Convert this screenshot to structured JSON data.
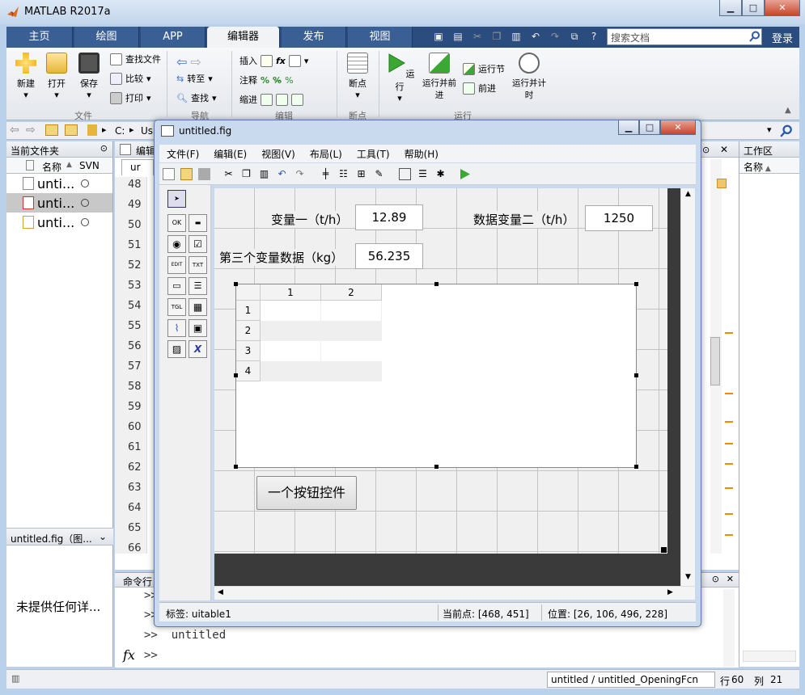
{
  "app": {
    "title": "MATLAB R2017a",
    "login": "登录",
    "search_placeholder": "搜索文档"
  },
  "tabs": [
    "主页",
    "绘图",
    "APP",
    "编辑器",
    "发布",
    "视图"
  ],
  "active_tab": "编辑器",
  "ribbon": {
    "file": {
      "new": "新建",
      "open": "打开",
      "save": "保存",
      "find_files": "查找文件",
      "compare": "比较",
      "print": "打印",
      "group": "文件"
    },
    "nav": {
      "goto": "转至",
      "find": "查找",
      "group": "导航"
    },
    "edit": {
      "insert": "插入",
      "comment": "注释",
      "indent": "缩进",
      "group": "编辑"
    },
    "breakpoints": {
      "label": "断点",
      "group": "断点"
    },
    "run": {
      "run": "运行",
      "run_advance": "运行并前进",
      "run_section": "运行节",
      "advance": "前进",
      "run_time": "运行并计时",
      "group": "运行"
    }
  },
  "address": {
    "path_start": "C:",
    "path_next": "Us"
  },
  "current_folder": {
    "title": "当前文件夹",
    "col_name": "名称",
    "col_svn": "SVN",
    "files": [
      {
        "name": "unti...",
        "selected": false
      },
      {
        "name": "unti...",
        "selected": true
      },
      {
        "name": "unti...",
        "selected": false
      }
    ],
    "details_title": "untitled.fig（图...",
    "details_text": "未提供任何详..."
  },
  "editor": {
    "tab_title": "编辑",
    "tab_file": "ur",
    "line_numbers": [
      "48",
      "49",
      "50",
      "51",
      "52",
      "53",
      "54",
      "55",
      "56",
      "57",
      "58",
      "59",
      "60",
      "61",
      "62",
      "63",
      "64",
      "65",
      "66"
    ]
  },
  "workspace": {
    "title": "工作区",
    "col_name": "名称"
  },
  "command_window": {
    "title": "命令行",
    "lines": [
      ">>",
      ">>",
      ">>  untitled",
      ">>"
    ],
    "fx": "fx"
  },
  "statusbar": {
    "file": "untitled / untitled_OpeningFcn",
    "line_label": "行",
    "line": "60",
    "col_label": "列",
    "col": "21"
  },
  "figure": {
    "title": "untitled.fig",
    "menu": [
      "文件(F)",
      "编辑(E)",
      "视图(V)",
      "布局(L)",
      "工具(T)",
      "帮助(H)"
    ],
    "palette": [
      "OK",
      "▬",
      "◉",
      "☑",
      "EDIT",
      "TXT",
      "▭",
      "☰",
      "TGL",
      "▦",
      "⌇",
      "▣",
      "▨",
      "X"
    ],
    "labels": {
      "var1": "变量一（t/h）",
      "var2": "数据变量二（t/h）",
      "var3": "第三个变量数据（kg）"
    },
    "values": {
      "var1": "12.89",
      "var2": "1250",
      "var3": "56.235"
    },
    "table": {
      "columns": [
        "1",
        "2"
      ],
      "rows": [
        "1",
        "2",
        "3",
        "4"
      ]
    },
    "button_label": "一个按钮控件",
    "status": {
      "tag": "标签: uitable1",
      "current_point": "当前点:  [468, 451]",
      "position": "位置: [26, 106, 496, 228]"
    }
  },
  "colors": {
    "accent": "#2a4c7e",
    "run_green": "#3aa832",
    "grid": "#c4c4c4"
  }
}
